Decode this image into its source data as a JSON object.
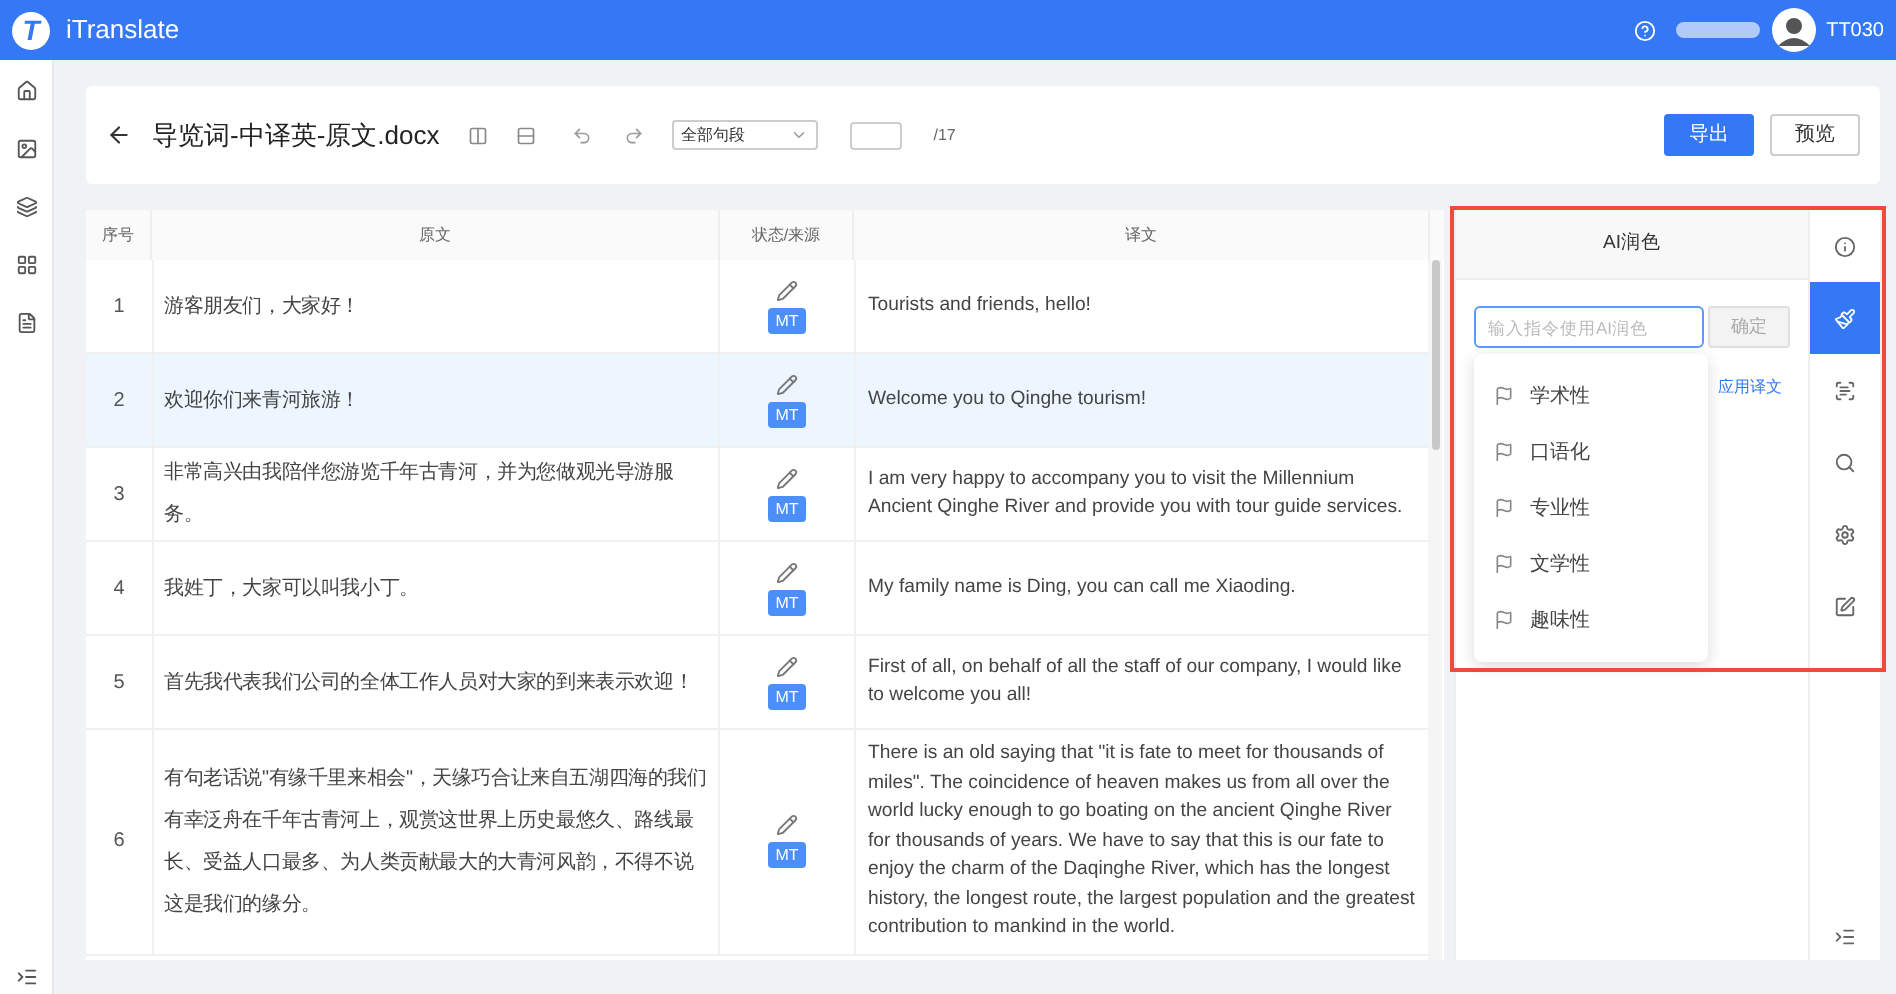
{
  "app": {
    "logo_mark": "T",
    "name": "iTranslate",
    "user": "TT030"
  },
  "toolbar": {
    "title": "导览词-中译英-原文.docx",
    "filter": "全部句段",
    "page_total": "/17",
    "buttons": [
      {
        "label": "导出",
        "kind": "primary"
      },
      {
        "label": "预览",
        "kind": "default"
      }
    ]
  },
  "table": {
    "columns": [
      "序号",
      "原文",
      "状态/来源",
      "译文"
    ],
    "rows": [
      {
        "index": "1",
        "source": "游客朋友们，大家好！",
        "status": "MT",
        "target": "Tourists and friends, hello!",
        "selected": false
      },
      {
        "index": "2",
        "source": "欢迎你们来青河旅游！",
        "status": "MT",
        "target": "Welcome you to Qinghe tourism!",
        "selected": true
      },
      {
        "index": "3",
        "source": "非常高兴由我陪伴您游览千年古青河，并为您做观光导游服务。",
        "status": "MT",
        "target": "I am very happy to accompany you to visit the Millennium Ancient Qinghe River and provide you with tour guide services.",
        "selected": false
      },
      {
        "index": "4",
        "source": "我姓丁，大家可以叫我小丁。",
        "status": "MT",
        "target": "My family name is Ding, you can call me Xiaoding.",
        "selected": false
      },
      {
        "index": "5",
        "source": "首先我代表我们公司的全体工作人员对大家的到来表示欢迎！",
        "status": "MT",
        "target": "First of all, on behalf of all the staff of our company, I would like to welcome you all!",
        "selected": false
      },
      {
        "index": "6",
        "source": "有句老话说\"有缘千里来相会\"，天缘巧合让来自五湖四海的我们有幸泛舟在千年古青河上，观赏这世界上历史最悠久、路线最长、受益人口最多、为人类贡献最大的大青河风韵，不得不说这是我们的缘分。",
        "status": "MT",
        "target": "There is an old saying that \"it is fate to meet for thousands of miles\". The coincidence of heaven makes us from all over the world lucky enough to go boating on the ancient Qinghe River for thousands of years. We have to say that this is our fate to enjoy the charm of the Daqinghe River, which has the longest history, the longest route, the largest population and the greatest contribution to mankind in the world.",
        "selected": false
      }
    ]
  },
  "ai_panel": {
    "title": "AI润色",
    "prompt_placeholder": "输入指令使用AI润色",
    "confirm": "确定",
    "apply_link": "应用译文",
    "menu": [
      {
        "label": "学术性"
      },
      {
        "label": "口语化"
      },
      {
        "label": "专业性"
      },
      {
        "label": "文学性"
      },
      {
        "label": "趣味性"
      }
    ]
  },
  "tool_rail": [
    {
      "kind": "info",
      "selected": false
    },
    {
      "kind": "polish",
      "selected": true
    },
    {
      "kind": "term",
      "selected": false
    },
    {
      "kind": "search",
      "selected": false
    },
    {
      "kind": "settings",
      "selected": false
    },
    {
      "kind": "edit",
      "selected": false
    }
  ]
}
